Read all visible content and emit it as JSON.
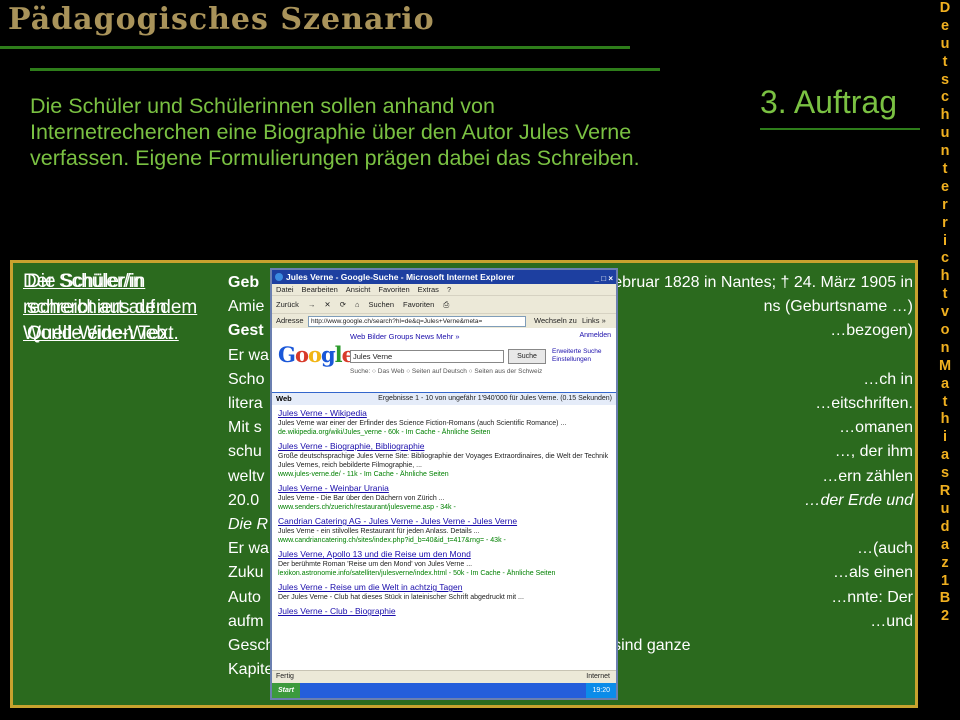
{
  "header": {
    "title": "Pädagogisches Szenario"
  },
  "side_credit": "Deutschunterricht von Mathias Rudaz 1B2",
  "heading": "3. Auftrag",
  "intro": "Die Schüler und Schülerinnen sollen anhand von Internetrecherchen eine Biographie über den Autor Jules Verne verfassen. Eigene Formulierungen prägen dabei das Schreiben.",
  "panel": {
    "label_a": "Der Schüler/in recherchiert auf dem World-Wide-Web.",
    "label_b": "Die Schüler/in schreibt aus den Quelle einen Text.",
    "bio_lines": [
      {
        "pre": "Geb",
        "bold": true,
        "mid": "",
        "rest": "8. Februar 1828  in Nantes; † 24. März 1905 in"
      },
      {
        "pre": "Amie",
        "rest": "ns (Geburtsname …)"
      },
      {
        "pre": "Gest",
        "bold": true,
        "rest": "…bezogen)"
      },
      {
        "pre": "Er wa",
        "rest": ""
      },
      {
        "pre": "Scho",
        "rest": "…ch in"
      },
      {
        "pre": "litera",
        "rest": "…eitschriften."
      },
      {
        "pre": "Mit s",
        "rest": "…omanen"
      },
      {
        "pre": "schu",
        "rest": "…, der ihm"
      },
      {
        "pre": "weltv",
        "rest": "…ern zählen"
      },
      {
        "pre": "20.0",
        "rest": "…der Erde und",
        "rest_italic": true
      },
      {
        "pre": "Die R",
        "pre_italic": true,
        "rest": ""
      },
      {
        "pre": "Er wa",
        "rest": "…(auch"
      },
      {
        "pre": "Zuku",
        "rest": "…als einen"
      },
      {
        "pre": "Auto",
        "rest": "…nnte: Der"
      },
      {
        "pre": "aufm",
        "rest": "…und"
      },
      {
        "pre": "Geschichte der bereisten Gebiete informiert; zuweilen sind ganze",
        "rest": ""
      },
      {
        "pre": "Kapitel rein informative Exkursionen…",
        "rest": ""
      }
    ]
  },
  "browser": {
    "title": "Jules Verne - Google-Suche - Microsoft Internet Explorer",
    "window_buttons": "_ □ ×",
    "menu": [
      "Datei",
      "Bearbeiten",
      "Ansicht",
      "Favoriten",
      "Extras",
      "?"
    ],
    "toolbar": [
      "Zurück",
      "→",
      "✕",
      "⟳",
      "⌂",
      "Suchen",
      "Favoriten",
      "⎙"
    ],
    "address_label": "Adresse",
    "url": "http://www.google.ch/search?hl=de&q=Jules+Verne&meta=",
    "go_label": "Wechseln zu",
    "links_label": "Links »",
    "google": {
      "logo": "Google",
      "tabs": "Web   Bilder   Groups   News   Mehr »",
      "login": "Anmelden",
      "query": "Jules Verne",
      "search_button": "Suche",
      "advanced": "Erweiterte Suche",
      "preferences": "Einstellungen",
      "options": "Suche: ○ Das Web ○ Seiten auf Deutsch ○ Seiten aus der Schweiz",
      "bar_label": "Web",
      "stats": "Ergebnisse 1 - 10 von ungefähr 1'940'000 für Jules Verne. (0.15 Sekunden)"
    },
    "results": [
      {
        "title": "Jules Verne - Wikipedia",
        "snippet": "Jules Verne war einer der Erfinder des Science Fiction-Romans (auch Scientific Romance) ...",
        "url": "de.wikipedia.org/wiki/Jules_verne - 60k - Im Cache - Ähnliche Seiten"
      },
      {
        "title": "Jules Verne - Biographie, Bibliographie",
        "snippet": "Große deutschsprachige Jules Verne Site: Bibliographie der Voyages Extraordinaires, die Welt der Technik Jules Vernes, reich bebilderte Filmographie, ...",
        "url": "www.jules-verne.de/ - 11k - Im Cache - Ähnliche Seiten"
      },
      {
        "title": "Jules Verne - Weinbar Urania",
        "snippet": "Jules Verne - Die Bar über den Dächern von Zürich ...",
        "url": "www.senders.ch/zuerich/restaurant/julesverne.asp - 34k -"
      },
      {
        "title": "Candrian Catering AG - Jules Verne - Jules Verne - Jules Verne",
        "snippet": "Jules Verne - ein stilvolles Restaurant für jeden Anlass. Details ...",
        "url": "www.candriancatering.ch/sites/index.php?id_b=40&id_t=417&rng= - 43k -"
      },
      {
        "title": "Jules Verne, Apollo 13 und die Reise um den Mond",
        "snippet": "Der berühmte Roman 'Reise um den Mond' von Jules Verne ...",
        "url": "lexikon.astronomie.info/satelliten/julesverne/index.html - 50k - Im Cache - Ähnliche Seiten"
      },
      {
        "title": "Jules Verne - Reise um die Welt in achtzig Tagen",
        "snippet": "Der Jules Verne - Club hat dieses Stück in lateinischer Schrift abgedruckt mit ...",
        "url": ""
      },
      {
        "title": "Jules Verne - Club - Biographie",
        "snippet": "",
        "url": ""
      }
    ],
    "status_text": "Fertig",
    "status_zone": "Internet",
    "taskbar_start": "Start",
    "clock": "19:20"
  }
}
